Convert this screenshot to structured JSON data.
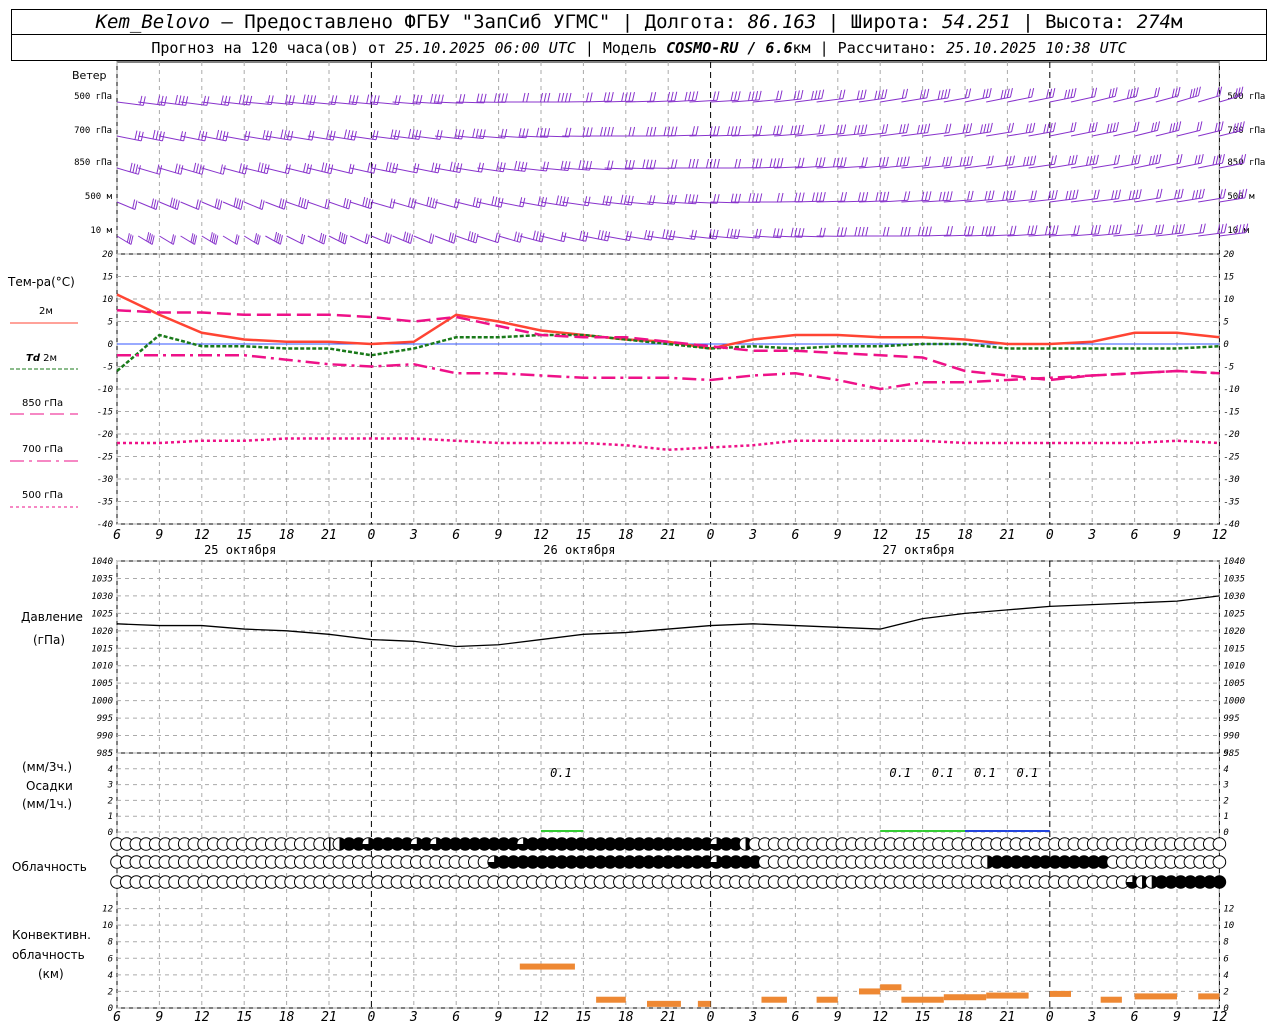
{
  "header": {
    "station": "Kem_Belovo",
    "provider": "– Предоставлено ФГБУ \"ЗапСиб УГМС\"",
    "lon_label": "| Долгота:",
    "lon": "86.163",
    "lat_label": "| Широта:",
    "lat": "54.251",
    "alt_label": "| Высота:",
    "alt": "274",
    "alt_unit": "м",
    "forecast_label": "Прогноз на 120 часа(ов) от",
    "forecast_time": "25.10.2025 06:00 UTC",
    "model_label": "| Модель",
    "model": "COSMO-RU / 6.6",
    "model_unit": "км",
    "calc_label": "| Рассчитано:",
    "calc_time": "25.10.2025 10:38 UTC"
  },
  "labels": {
    "wind": "Ветер",
    "wind_levels": [
      "500 гПа",
      "700 гПа",
      "850 гПа",
      "500 м",
      "10 м"
    ],
    "temp": "Тем-ра(°С)",
    "legend_2m": "2м",
    "legend_td_a": "Td",
    "legend_td_b": "2м",
    "legend_850": "850 гПа",
    "legend_700": "700 гПа",
    "legend_500": "500 гПа",
    "pressure_a": "Давление",
    "pressure_b": "(гПа)",
    "precip_a": "(мм/3ч.)",
    "precip_b": "Осадки",
    "precip_c": "(мм/1ч.)",
    "cloud": "Облачность",
    "conv_a": "Конвективн.",
    "conv_b": "облачность",
    "conv_c": "(км)"
  },
  "colors": {
    "t2m": "#ff4433",
    "td2m": "#1a7a1a",
    "levels": "#ee1188",
    "wind": "#8833cc",
    "precip_green": "#33cc33",
    "precip_blue": "#2244dd",
    "conv": "#ee8833",
    "zero_line": "#3355ff"
  },
  "chart_data": {
    "type": "line",
    "x_ticks": [
      "6",
      "9",
      "12",
      "15",
      "18",
      "21",
      "0",
      "3",
      "6",
      "9",
      "12",
      "15",
      "18",
      "21",
      "0",
      "3",
      "6",
      "9",
      "12",
      "15",
      "18",
      "21",
      "0",
      "3",
      "6",
      "9",
      "12"
    ],
    "day_labels": [
      "25 октября",
      "26 октября",
      "27 октября"
    ],
    "temperature": {
      "ylim": [
        -40,
        20
      ],
      "yticks": [
        20,
        15,
        10,
        5,
        0,
        -5,
        -10,
        -15,
        -20,
        -25,
        -30,
        -35,
        -40
      ],
      "series": [
        {
          "name": "2м",
          "values": [
            11,
            6.5,
            2.5,
            1,
            0.5,
            0.5,
            0,
            0.5,
            6.5,
            5,
            3,
            2,
            1,
            0.5,
            -1,
            1,
            2,
            2,
            1.5,
            1.5,
            1,
            0,
            0,
            0.5,
            2.5,
            2.5,
            1.5
          ]
        },
        {
          "name": "Td 2м",
          "values": [
            -6,
            2,
            -0.5,
            -0.5,
            -1,
            -1,
            -2.5,
            -1,
            1.5,
            1.5,
            2,
            2,
            1,
            0,
            -1,
            -0.5,
            -1,
            -0.5,
            -0.5,
            0,
            0,
            -1,
            -1,
            -1,
            -1,
            -1,
            -0.5
          ]
        },
        {
          "name": "850 гПа",
          "values": [
            7.5,
            7,
            7,
            6.5,
            6.5,
            6.5,
            6,
            5,
            6,
            4,
            2,
            1.5,
            1.5,
            0.5,
            -0.5,
            -1.5,
            -1.5,
            -2,
            -2.5,
            -3,
            -6,
            -7,
            -8,
            -7,
            -6.5,
            -6,
            -6.5
          ]
        },
        {
          "name": "700 гПа",
          "values": [
            -2.5,
            -2.5,
            -2.5,
            -2.5,
            -3.5,
            -4.5,
            -5,
            -4.5,
            -6.5,
            -6.5,
            -7,
            -7.5,
            -7.5,
            -7.5,
            -8,
            -7,
            -6.5,
            -8,
            -10,
            -8.5,
            -8.5,
            -8,
            -7.5,
            -7,
            -6.5,
            -6,
            -6.5
          ]
        },
        {
          "name": "500 гПа",
          "values": [
            -22,
            -22,
            -21.5,
            -21.5,
            -21,
            -21,
            -21,
            -21,
            -21.5,
            -22,
            -22,
            -22,
            -22.5,
            -23.5,
            -23,
            -22.5,
            -21.5,
            -21.5,
            -21.5,
            -21.5,
            -22,
            -22,
            -22,
            -22,
            -22,
            -21.5,
            -22
          ]
        }
      ]
    },
    "pressure": {
      "ylim": [
        985,
        1040
      ],
      "yticks": [
        1040,
        1035,
        1030,
        1025,
        1020,
        1015,
        1010,
        1005,
        1000,
        995,
        990,
        985
      ],
      "values": [
        1022,
        1021.5,
        1021.5,
        1020.5,
        1020,
        1019,
        1017.5,
        1017,
        1015.5,
        1016,
        1017.5,
        1019,
        1019.5,
        1020.5,
        1021.5,
        1022,
        1021.5,
        1021,
        1020.5,
        1023.5,
        1025,
        1026,
        1027,
        1027.5,
        1028,
        1028.5,
        1030
      ]
    },
    "precipitation": {
      "ylim": [
        0,
        5
      ],
      "yticks": [
        5,
        4,
        3,
        2,
        1,
        0
      ],
      "annotations": [
        {
          "x": 10,
          "text": "0.1"
        },
        {
          "x": 18,
          "text": "0.1"
        },
        {
          "x": 19,
          "text": "0.1"
        },
        {
          "x": 20,
          "text": "0.1"
        },
        {
          "x": 21,
          "text": "0.1"
        }
      ],
      "bars": [
        {
          "x0": 10,
          "x1": 11,
          "value": 0.1,
          "color": "green"
        },
        {
          "x0": 18,
          "x1": 19,
          "value": 0.05,
          "color": "green"
        },
        {
          "x0": 19,
          "x1": 20,
          "value": 0.1,
          "color": "green"
        },
        {
          "x0": 20,
          "x1": 21,
          "value": 0.1,
          "color": "blue"
        },
        {
          "x0": 21,
          "x1": 22,
          "value": 0.1,
          "color": "blue"
        }
      ]
    },
    "clouds": {
      "rows": [
        "0000000000000000000000124434444343444444443444444444444444444434420000000000000000000000000000000000000000000000000",
        "0000000000000000000000000000000000000003444444444444444444444434444000000000000000000000002444444444444000000000000",
        "0000000000000000000000000000000000000000000000000000000000000000000000000000000000000000000000000000000003224444444"
      ]
    },
    "convective": {
      "ylim": [
        0,
        14
      ],
      "yticks": [
        12,
        10,
        8,
        6,
        4,
        2,
        0
      ],
      "segments": [
        {
          "x0": 9.5,
          "x1": 10.8,
          "value": 5
        },
        {
          "x0": 11.3,
          "x1": 12.0,
          "value": 1
        },
        {
          "x0": 12.5,
          "x1": 13.3,
          "value": 0.5
        },
        {
          "x0": 13.7,
          "x1": 14.0,
          "value": 0.5
        },
        {
          "x0": 15.2,
          "x1": 15.8,
          "value": 1
        },
        {
          "x0": 16.5,
          "x1": 17.0,
          "value": 1
        },
        {
          "x0": 17.5,
          "x1": 18.0,
          "value": 2
        },
        {
          "x0": 18.0,
          "x1": 18.5,
          "value": 2.5
        },
        {
          "x0": 18.5,
          "x1": 19.5,
          "value": 1
        },
        {
          "x0": 19.5,
          "x1": 20.5,
          "value": 1.3
        },
        {
          "x0": 20.5,
          "x1": 21.5,
          "value": 1.5
        },
        {
          "x0": 22.0,
          "x1": 22.5,
          "value": 1.7
        },
        {
          "x0": 23.2,
          "x1": 23.7,
          "value": 1
        },
        {
          "x0": 24.0,
          "x1": 25.0,
          "value": 1.4
        },
        {
          "x0": 25.5,
          "x1": 26.0,
          "value": 1.4
        }
      ]
    },
    "wind": {
      "levels": [
        "500 гПа",
        "700 гПа",
        "850 гПа",
        "500 м",
        "10 м"
      ],
      "direction_deg": [
        [
          250,
          250,
          250,
          255,
          255,
          255,
          255,
          260,
          265,
          270,
          270,
          275,
          275,
          280,
          280,
          285,
          290,
          290,
          295,
          295,
          300,
          300,
          300,
          305,
          305,
          310,
          310
        ],
        [
          240,
          240,
          240,
          245,
          245,
          245,
          250,
          250,
          255,
          260,
          265,
          270,
          270,
          275,
          275,
          280,
          285,
          285,
          290,
          290,
          295,
          295,
          300,
          300,
          305,
          305,
          305
        ],
        [
          230,
          230,
          230,
          235,
          235,
          235,
          240,
          240,
          245,
          250,
          255,
          260,
          265,
          270,
          270,
          275,
          280,
          280,
          285,
          285,
          290,
          290,
          295,
          295,
          300,
          300,
          300
        ],
        [
          220,
          220,
          220,
          220,
          225,
          225,
          230,
          230,
          235,
          240,
          245,
          250,
          255,
          260,
          265,
          270,
          275,
          275,
          280,
          280,
          285,
          285,
          290,
          290,
          295,
          295,
          295
        ],
        [
          210,
          210,
          210,
          210,
          215,
          215,
          220,
          220,
          225,
          230,
          235,
          240,
          245,
          250,
          255,
          260,
          265,
          270,
          270,
          275,
          275,
          280,
          280,
          285,
          285,
          290,
          290
        ]
      ]
    }
  }
}
